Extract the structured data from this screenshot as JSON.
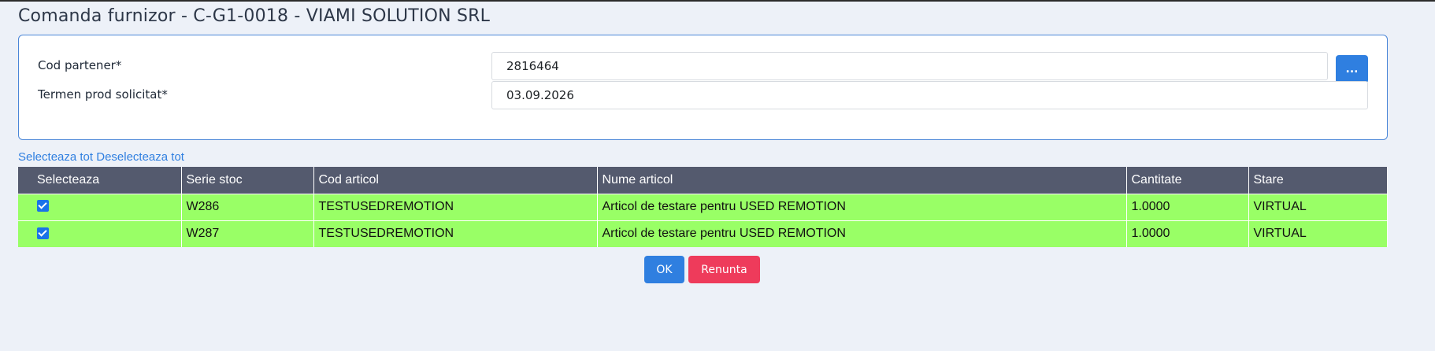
{
  "page": {
    "title": "Comanda furnizor - C-G1-0018 - VIAMI SOLUTION SRL"
  },
  "form": {
    "partner_code": {
      "label": "Cod partener*",
      "value": "2816464"
    },
    "deadline": {
      "label": "Termen prod solicitat*",
      "value": "03.09.2026"
    },
    "lookup_label": "..."
  },
  "selection": {
    "select_all": "Selecteaza tot",
    "deselect_all": "Deselecteaza tot"
  },
  "table": {
    "headers": [
      "Selecteaza",
      "Serie stoc",
      "Cod articol",
      "Nume articol",
      "Cantitate",
      "Stare"
    ],
    "rows": [
      {
        "selected": true,
        "serie": "W286",
        "cod": "TESTUSEDREMOTION",
        "nume": "Articol de testare pentru USED REMOTION",
        "cantitate": "1.0000",
        "stare": "VIRTUAL"
      },
      {
        "selected": true,
        "serie": "W287",
        "cod": "TESTUSEDREMOTION",
        "nume": "Articol de testare pentru USED REMOTION",
        "cantitate": "1.0000",
        "stare": "VIRTUAL"
      }
    ]
  },
  "actions": {
    "ok": "OK",
    "cancel": "Renunta"
  },
  "colors": {
    "accent": "#2f7fe0",
    "danger": "#ee3b5b",
    "row_bg": "#99ff66",
    "header_bg": "#545a6e"
  }
}
